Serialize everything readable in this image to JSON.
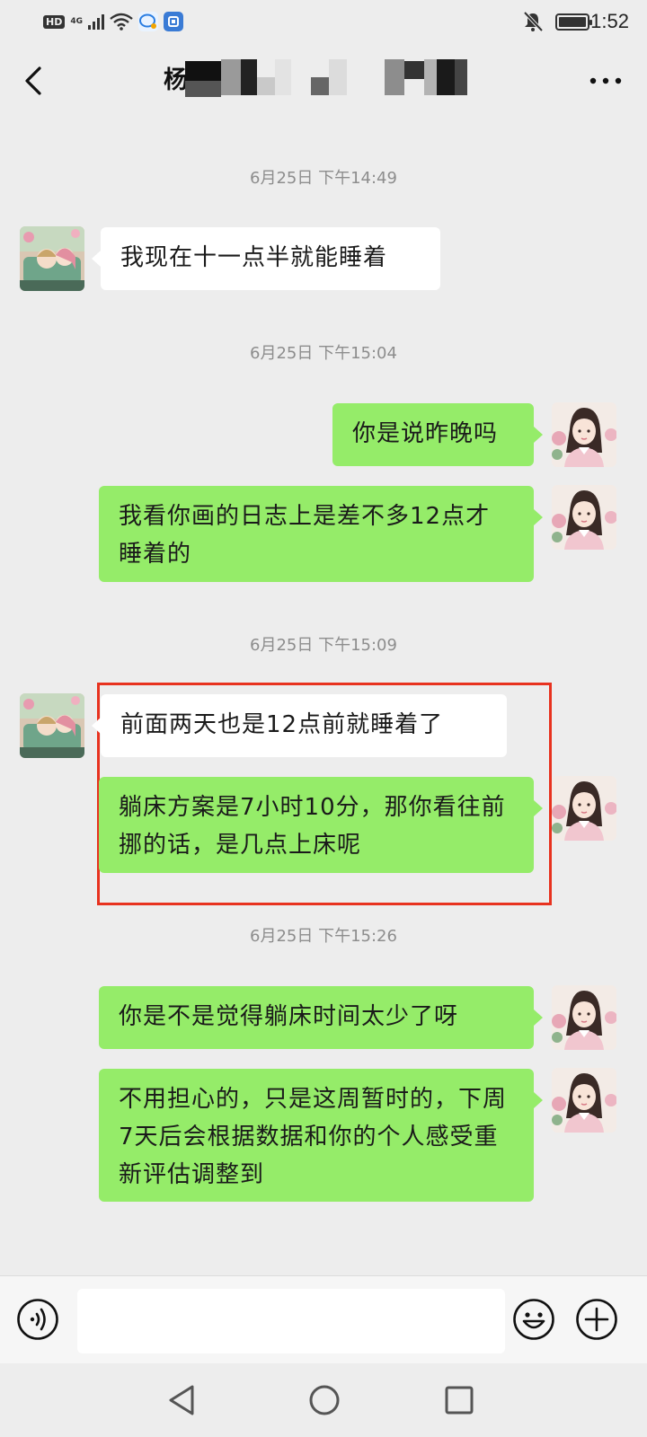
{
  "status_bar": {
    "network_badge": "HD",
    "network_type": "4G",
    "time": "1:52"
  },
  "header": {
    "title_visible_char": "杨"
  },
  "messages": [
    {
      "type": "timestamp",
      "text": "6月25日 下午14:49"
    },
    {
      "type": "message",
      "direction": "in",
      "text": "我现在十一点半就能睡着"
    },
    {
      "type": "timestamp",
      "text": "6月25日 下午15:04"
    },
    {
      "type": "message",
      "direction": "out",
      "text": "你是说昨晚吗"
    },
    {
      "type": "message",
      "direction": "out",
      "text": "我看你画的日志上是差不多12点才睡着的"
    },
    {
      "type": "timestamp",
      "text": "6月25日 下午15:09"
    },
    {
      "type": "message",
      "direction": "in",
      "text": "前面两天也是12点前就睡着了"
    },
    {
      "type": "message",
      "direction": "out",
      "text": "躺床方案是7小时10分，那你看往前挪的话，是几点上床呢"
    },
    {
      "type": "timestamp",
      "text": "6月25日 下午15:26"
    },
    {
      "type": "message",
      "direction": "out",
      "text": "你是不是觉得躺床时间太少了呀"
    },
    {
      "type": "message",
      "direction": "out",
      "text": "不用担心的，只是这周暂时的，下周7天后会根据数据和你的个人感受重新评估调整到"
    }
  ],
  "input": {
    "value": "",
    "placeholder": ""
  },
  "colors": {
    "background": "#ededed",
    "outgoing_bubble": "#95ec69",
    "incoming_bubble": "#ffffff",
    "highlight_border": "#e8321f",
    "timestamp_text": "#8d8d8d"
  },
  "icons": {
    "back": "chevron-left-icon",
    "more": "more-dots-icon",
    "voice": "voice-icon",
    "emoji": "emoji-icon",
    "add": "plus-icon",
    "nav_back": "triangle-back-icon",
    "nav_home": "circle-home-icon",
    "nav_recent": "square-recent-icon"
  }
}
